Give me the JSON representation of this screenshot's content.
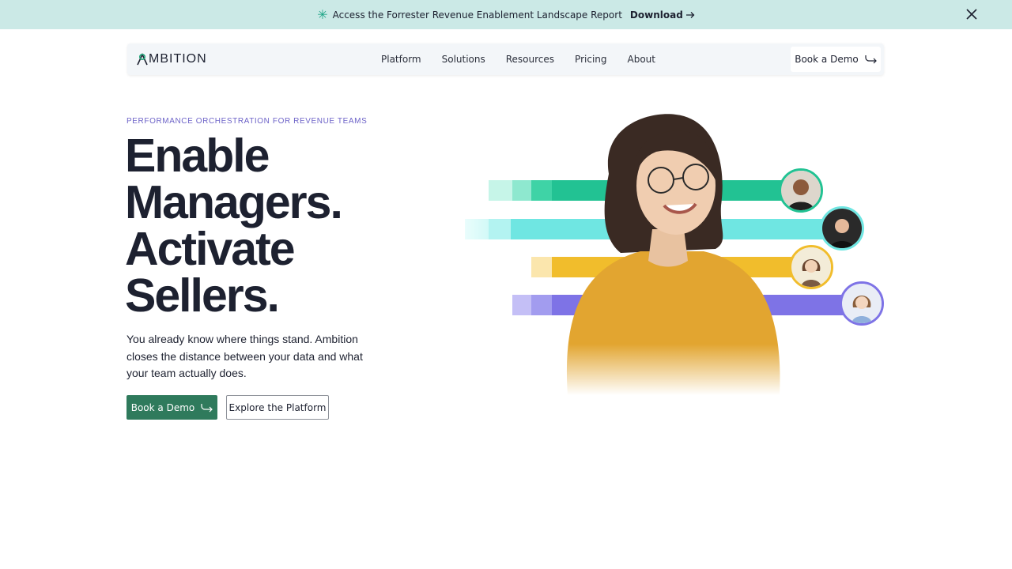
{
  "announcement": {
    "text": "Access the Forrester Revenue Enablement Landscape Report",
    "link_label": "Download"
  },
  "nav": {
    "logo_text": "MBITION",
    "menu": [
      "Platform",
      "Solutions",
      "Resources",
      "Pricing",
      "About"
    ],
    "cta_label": "Book a Demo"
  },
  "hero": {
    "eyebrow": "PERFORMANCE ORCHESTRATION FOR REVENUE TEAMS",
    "headline_lines": [
      "Enable",
      "Managers.",
      "Activate",
      "Sellers."
    ],
    "subtext": "You already know where things stand. Ambition closes the distance between your data and what your team actually does.",
    "primary_cta": "Book a Demo",
    "secondary_cta": "Explore the Platform"
  },
  "colors": {
    "banner_bg": "#cbe9e6",
    "brand_green": "#2f7a5c",
    "eyebrow_purple": "#6d63c8",
    "bar_green": "#22c293",
    "bar_cyan": "#6fe6e2",
    "bar_yellow": "#f1bd2c",
    "bar_purple": "#7e73e6"
  }
}
